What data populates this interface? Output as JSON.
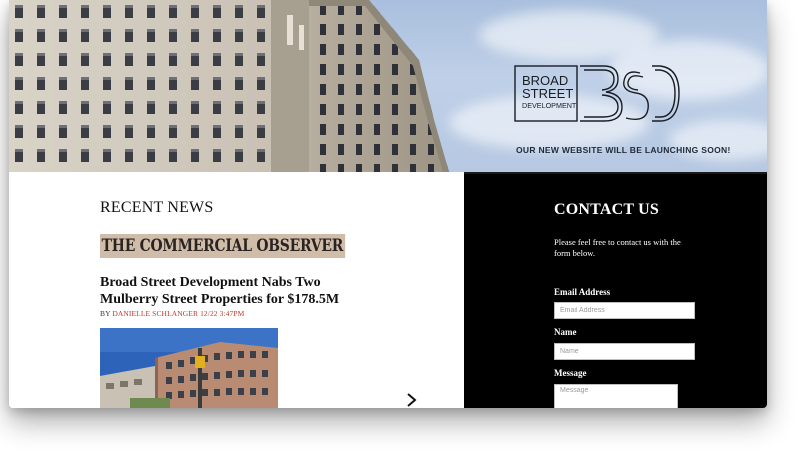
{
  "hero": {
    "logo_lines": [
      "BROAD",
      "STREET",
      "DEVELOPMENT"
    ],
    "tagline": "OUR NEW WEBSITE WILL BE LAUNCHING SOON!"
  },
  "news": {
    "section_title": "RECENT NEWS",
    "source": "THE COMMERCIAL OBSERVER",
    "headline": "Broad Street Development Nabs Two Mulberry Street Properties for $178.5M",
    "byline_prefix": "BY ",
    "author": "DANIELLE SCHLANGER",
    "date": "12/22 3:47PM"
  },
  "contact": {
    "title": "CONTACT US",
    "intro": "Please feel free to contact us with the form below.",
    "email_label": "Email Address",
    "email_placeholder": "Email Address",
    "name_label": "Name",
    "name_placeholder": "Name",
    "message_label": "Message",
    "message_placeholder": "Message"
  },
  "colors": {
    "accent_red": "#c0392b",
    "badge_tan": "#cfbca9",
    "contact_bg": "#000000"
  }
}
